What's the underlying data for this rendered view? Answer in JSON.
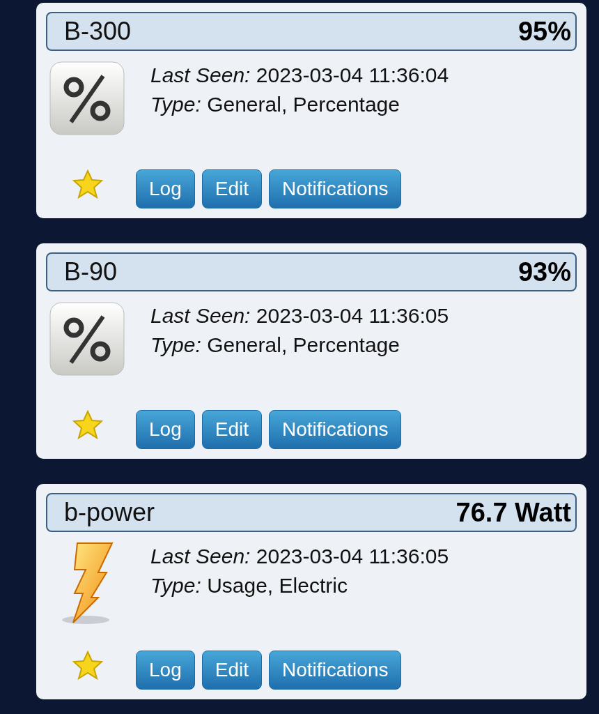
{
  "devices": [
    {
      "name": "B-300",
      "value": "95%",
      "kind": "percent",
      "details": [
        "*Last Seen:* 2023-03-04 11:36:04",
        "*Type:* General, Percentage"
      ],
      "favorite": true,
      "buttons": [
        "Log",
        "Edit",
        "Notifications"
      ]
    },
    {
      "name": "B-90",
      "value": "93%",
      "kind": "percent",
      "details": [
        "*Last Seen:* 2023-03-04 11:36:05",
        "*Type:* General, Percentage"
      ],
      "favorite": true,
      "buttons": [
        "Log",
        "Edit",
        "Notifications"
      ]
    },
    {
      "name": "b-power",
      "value": "76.7 Watt",
      "kind": "lightning",
      "details": [
        "*Last Seen:* 2023-03-04 11:36:05",
        "*Type:* Usage, Electric"
      ],
      "favorite": true,
      "buttons": [
        "Log",
        "Edit",
        "Notifications"
      ]
    }
  ]
}
